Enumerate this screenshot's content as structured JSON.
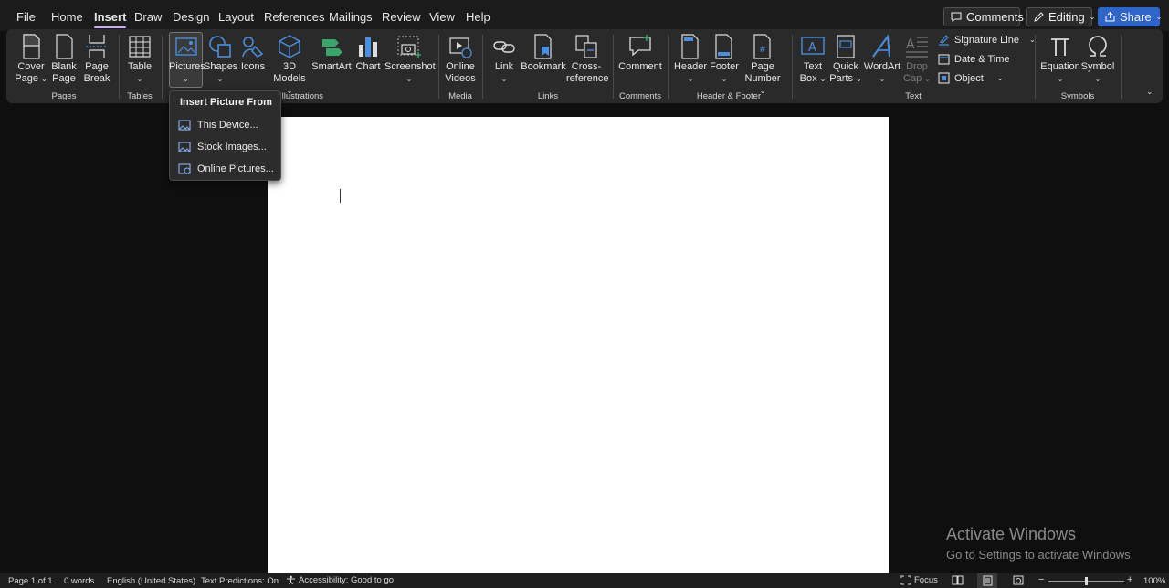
{
  "menu": {
    "tabs": [
      "File",
      "Home",
      "Insert",
      "Draw",
      "Design",
      "Layout",
      "References",
      "Mailings",
      "Review",
      "View",
      "Help"
    ],
    "active_tab": "Insert",
    "comments_label": "Comments",
    "editing_label": "Editing",
    "share_label": "Share"
  },
  "ribbon": {
    "groups": {
      "pages": "Pages",
      "tables": "Tables",
      "illustrations": "Illustrations",
      "media": "Media",
      "links": "Links",
      "comments": "Comments",
      "header_footer": "Header & Footer",
      "text": "Text",
      "symbols": "Symbols"
    },
    "buttons": {
      "cover_page": [
        "Cover",
        "Page"
      ],
      "blank_page": [
        "Blank",
        "Page"
      ],
      "page_break": [
        "Page",
        "Break"
      ],
      "table": "Table",
      "pictures": "Pictures",
      "shapes": "Shapes",
      "icons": "Icons",
      "models_3d": [
        "3D",
        "Models"
      ],
      "smartart": "SmartArt",
      "chart": "Chart",
      "screenshot": "Screenshot",
      "online_videos": [
        "Online",
        "Videos"
      ],
      "link": "Link",
      "bookmark": "Bookmark",
      "cross_reference": [
        "Cross-",
        "reference"
      ],
      "comment": "Comment",
      "header": "Header",
      "footer": "Footer",
      "page_number": [
        "Page",
        "Number"
      ],
      "text_box": [
        "Text",
        "Box"
      ],
      "quick_parts": [
        "Quick",
        "Parts"
      ],
      "wordart": "WordArt",
      "drop_cap": [
        "Drop",
        "Cap"
      ],
      "signature_line": "Signature Line",
      "date_time": "Date & Time",
      "object": "Object",
      "equation": "Equation",
      "symbol": "Symbol"
    }
  },
  "dropdown": {
    "title": "Insert Picture From",
    "items": [
      "This Device...",
      "Stock Images...",
      "Online Pictures..."
    ]
  },
  "watermark": {
    "line1": "Activate Windows",
    "line2": "Go to Settings to activate Windows."
  },
  "status": {
    "page": "Page 1 of 1",
    "words": "0 words",
    "language": "English (United States)",
    "predictions": "Text Predictions: On",
    "accessibility": "Accessibility: Good to go",
    "focus": "Focus",
    "zoom": "100%"
  },
  "colors": {
    "accent": "#c7a9ff",
    "icon_blue": "#4a8fe0",
    "share_blue": "#2f65c8"
  }
}
